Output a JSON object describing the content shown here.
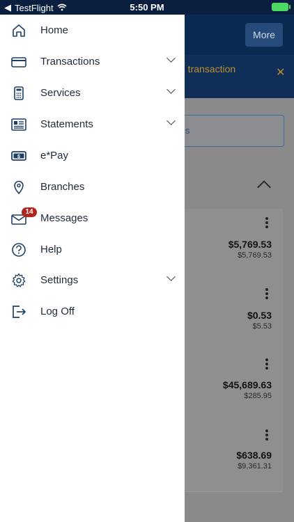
{
  "status": {
    "app": "TestFlight",
    "time": "5:50 PM"
  },
  "header": {
    "more_label": "More"
  },
  "alert": {
    "text": "d transaction",
    "close": "✕"
  },
  "search": {
    "text": "ls"
  },
  "accounts": [
    {
      "amount": "$5,769.53",
      "secondary": "$5,769.53"
    },
    {
      "amount": "$0.53",
      "secondary": "$5.53"
    },
    {
      "amount": "$45,689.63",
      "secondary": "$285.95"
    },
    {
      "amount": "$638.69",
      "secondary": "$9,361.31"
    }
  ],
  "menu": [
    {
      "label": "Home",
      "icon": "home-icon"
    },
    {
      "label": "Transactions",
      "icon": "card-icon"
    },
    {
      "label": "Services",
      "icon": "calculator-icon"
    },
    {
      "label": "Statements",
      "icon": "statement-icon"
    },
    {
      "label": "e*Pay",
      "icon": "dollar-bill-icon"
    },
    {
      "label": "Branches",
      "icon": "location-pin-icon"
    },
    {
      "label": "Messages",
      "icon": "envelope-icon",
      "badge": "14"
    },
    {
      "label": "Help",
      "icon": "help-icon"
    },
    {
      "label": "Settings",
      "icon": "gear-icon"
    },
    {
      "label": "Log Off",
      "icon": "logout-icon"
    }
  ],
  "colors": {
    "accent": "#0b2a52",
    "badge": "#b3261e",
    "battery": "#4cd964"
  }
}
